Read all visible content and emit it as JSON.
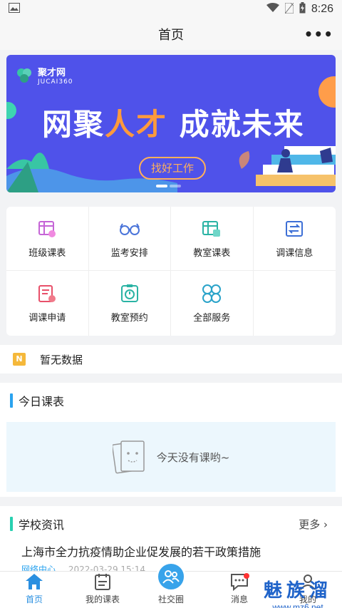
{
  "status_bar": {
    "time": "8:26"
  },
  "header": {
    "title": "首页"
  },
  "banner": {
    "logo_name": "聚才网",
    "logo_sub": "JUCAI360",
    "slogan_a": "网聚",
    "slogan_b": "人才",
    "slogan_c": "成就未来",
    "button": "找好工作"
  },
  "grid": {
    "items": [
      {
        "label": "班级课表",
        "icon": "class-schedule-icon",
        "color": "#c565d6"
      },
      {
        "label": "监考安排",
        "icon": "glasses-icon",
        "color": "#4a74d9"
      },
      {
        "label": "教室课表",
        "icon": "classroom-schedule-icon",
        "color": "#2ab3a4"
      },
      {
        "label": "调课信息",
        "icon": "swap-info-icon",
        "color": "#3d6fd6"
      },
      {
        "label": "调课申请",
        "icon": "application-icon",
        "color": "#e8506a"
      },
      {
        "label": "教室预约",
        "icon": "reservation-icon",
        "color": "#2ab3a4"
      },
      {
        "label": "全部服务",
        "icon": "all-services-icon",
        "color": "#2aa3c9"
      }
    ]
  },
  "notice": {
    "icon_letter": "N",
    "text": "暂无数据"
  },
  "today": {
    "title": "今日课表",
    "empty_text": "今天没有课哟~"
  },
  "news": {
    "title": "学校资讯",
    "more": "更多",
    "item": {
      "title": "上海市全力抗疫情助企业促发展的若干政策措施",
      "source": "网络中心",
      "date": "2022-03-29 15:14"
    }
  },
  "tabbar": {
    "tabs": [
      {
        "label": "首页",
        "icon": "home-icon"
      },
      {
        "label": "我的课表",
        "icon": "calendar-icon"
      },
      {
        "label": "社交圈",
        "icon": "people-icon"
      },
      {
        "label": "消息",
        "icon": "message-icon"
      },
      {
        "label": "我的",
        "icon": "profile-icon"
      }
    ]
  },
  "watermark": {
    "big": "魅族溜",
    "url": "www.mz6.net"
  },
  "colors": {
    "accent": "#2aa3ef",
    "banner": "#4f52ea",
    "teal": "#27d0b0"
  }
}
